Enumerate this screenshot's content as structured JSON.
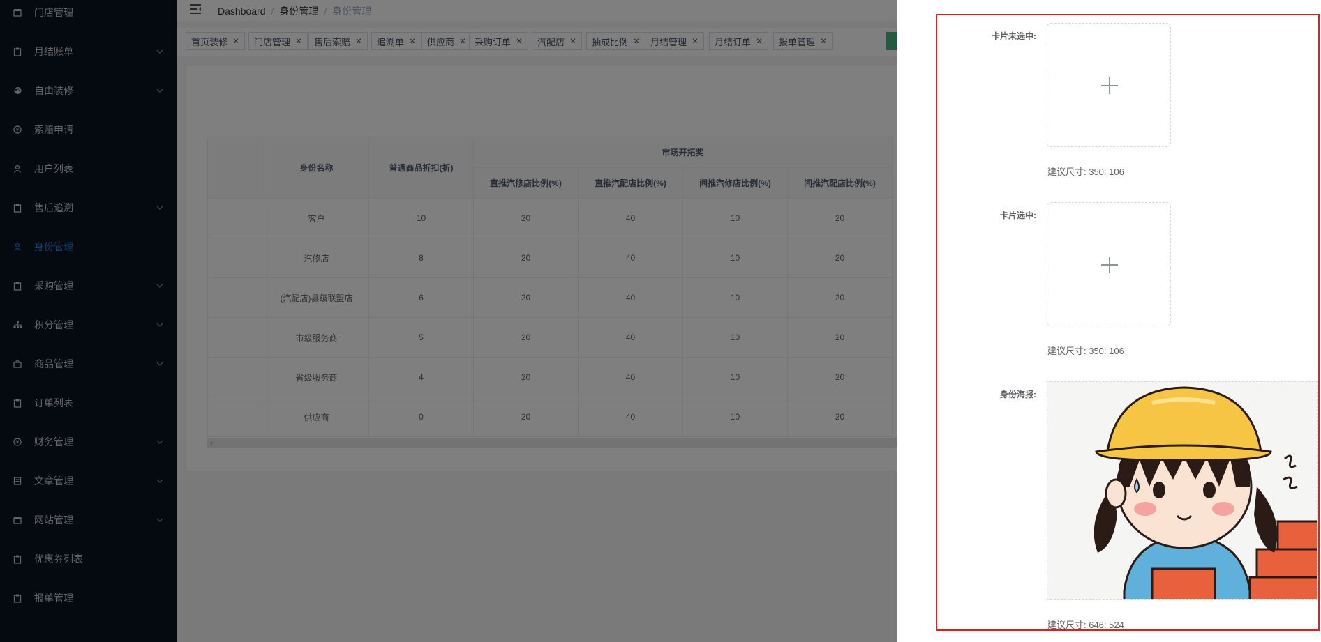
{
  "sidebar": {
    "items": [
      {
        "label": "门店管理",
        "icon": "shop-icon",
        "arrow": false,
        "active": false
      },
      {
        "label": "月结账单",
        "icon": "clipboard-icon",
        "arrow": true,
        "active": false
      },
      {
        "label": "自由装修",
        "icon": "palette-icon",
        "arrow": true,
        "active": false
      },
      {
        "label": "索赔申请",
        "icon": "coin-icon",
        "arrow": false,
        "active": false
      },
      {
        "label": "用户列表",
        "icon": "user-icon",
        "arrow": false,
        "active": false
      },
      {
        "label": "售后追溯",
        "icon": "clipboard-icon",
        "arrow": true,
        "active": false
      },
      {
        "label": "身份管理",
        "icon": "user-icon",
        "arrow": false,
        "active": true
      },
      {
        "label": "采购管理",
        "icon": "clipboard-icon",
        "arrow": true,
        "active": false
      },
      {
        "label": "积分管理",
        "icon": "tree-icon",
        "arrow": true,
        "active": false
      },
      {
        "label": "商品管理",
        "icon": "bag-icon",
        "arrow": true,
        "active": false
      },
      {
        "label": "订单列表",
        "icon": "clipboard-icon",
        "arrow": false,
        "active": false
      },
      {
        "label": "财务管理",
        "icon": "coin-icon",
        "arrow": true,
        "active": false
      },
      {
        "label": "文章管理",
        "icon": "document-icon",
        "arrow": true,
        "active": false
      },
      {
        "label": "网站管理",
        "icon": "shop-icon",
        "arrow": true,
        "active": false
      },
      {
        "label": "优惠券列表",
        "icon": "clipboard-icon",
        "arrow": false,
        "active": false
      },
      {
        "label": "报单管理",
        "icon": "clipboard-icon",
        "arrow": false,
        "active": false
      }
    ]
  },
  "breadcrumb": {
    "home": "Dashboard",
    "parent": "身份管理",
    "current": "身份管理",
    "separator": "/"
  },
  "tags": [
    "首页装修",
    "门店管理",
    "售后索赔",
    "追溯单",
    "供应商",
    "采购订单",
    "汽配店",
    "抽成比例",
    "月结管理",
    "月结订单",
    "报单管理"
  ],
  "table": {
    "headers": {
      "name": "身份名称",
      "discount": "普通商品折扣(折)",
      "group": "市场开拓奖",
      "sub": [
        "直推汽修店比例(%)",
        "直推汽配店比例(%)",
        "间推汽修店比例(%)",
        "间推汽配店比例(%)"
      ]
    },
    "rows": [
      {
        "name": "客户",
        "cells": [
          "10",
          "20",
          "40",
          "10",
          "20"
        ]
      },
      {
        "name": "汽修店",
        "cells": [
          "8",
          "20",
          "40",
          "10",
          "20"
        ]
      },
      {
        "name": "(汽配店)县级联盟店",
        "cells": [
          "6",
          "20",
          "40",
          "10",
          "20"
        ]
      },
      {
        "name": "市级服务商",
        "cells": [
          "5",
          "20",
          "40",
          "10",
          "20"
        ]
      },
      {
        "name": "省级服务商",
        "cells": [
          "4",
          "20",
          "40",
          "10",
          "20"
        ]
      },
      {
        "name": "供应商",
        "cells": [
          "0",
          "20",
          "40",
          "10",
          "20"
        ]
      }
    ]
  },
  "drawer": {
    "card_unselected": {
      "label": "卡片未选中:",
      "hint": "建议尺寸: 350: 106"
    },
    "card_selected": {
      "label": "卡片选中:",
      "hint": "建议尺寸: 350: 106"
    },
    "poster": {
      "label": "身份海报:",
      "hint": "建议尺寸: 646: 524"
    }
  },
  "colors": {
    "sidebar_bg": "#0b1420",
    "active": "#1f7ae0",
    "highlight_border": "#e02020",
    "tag_accent": "#42b983"
  }
}
